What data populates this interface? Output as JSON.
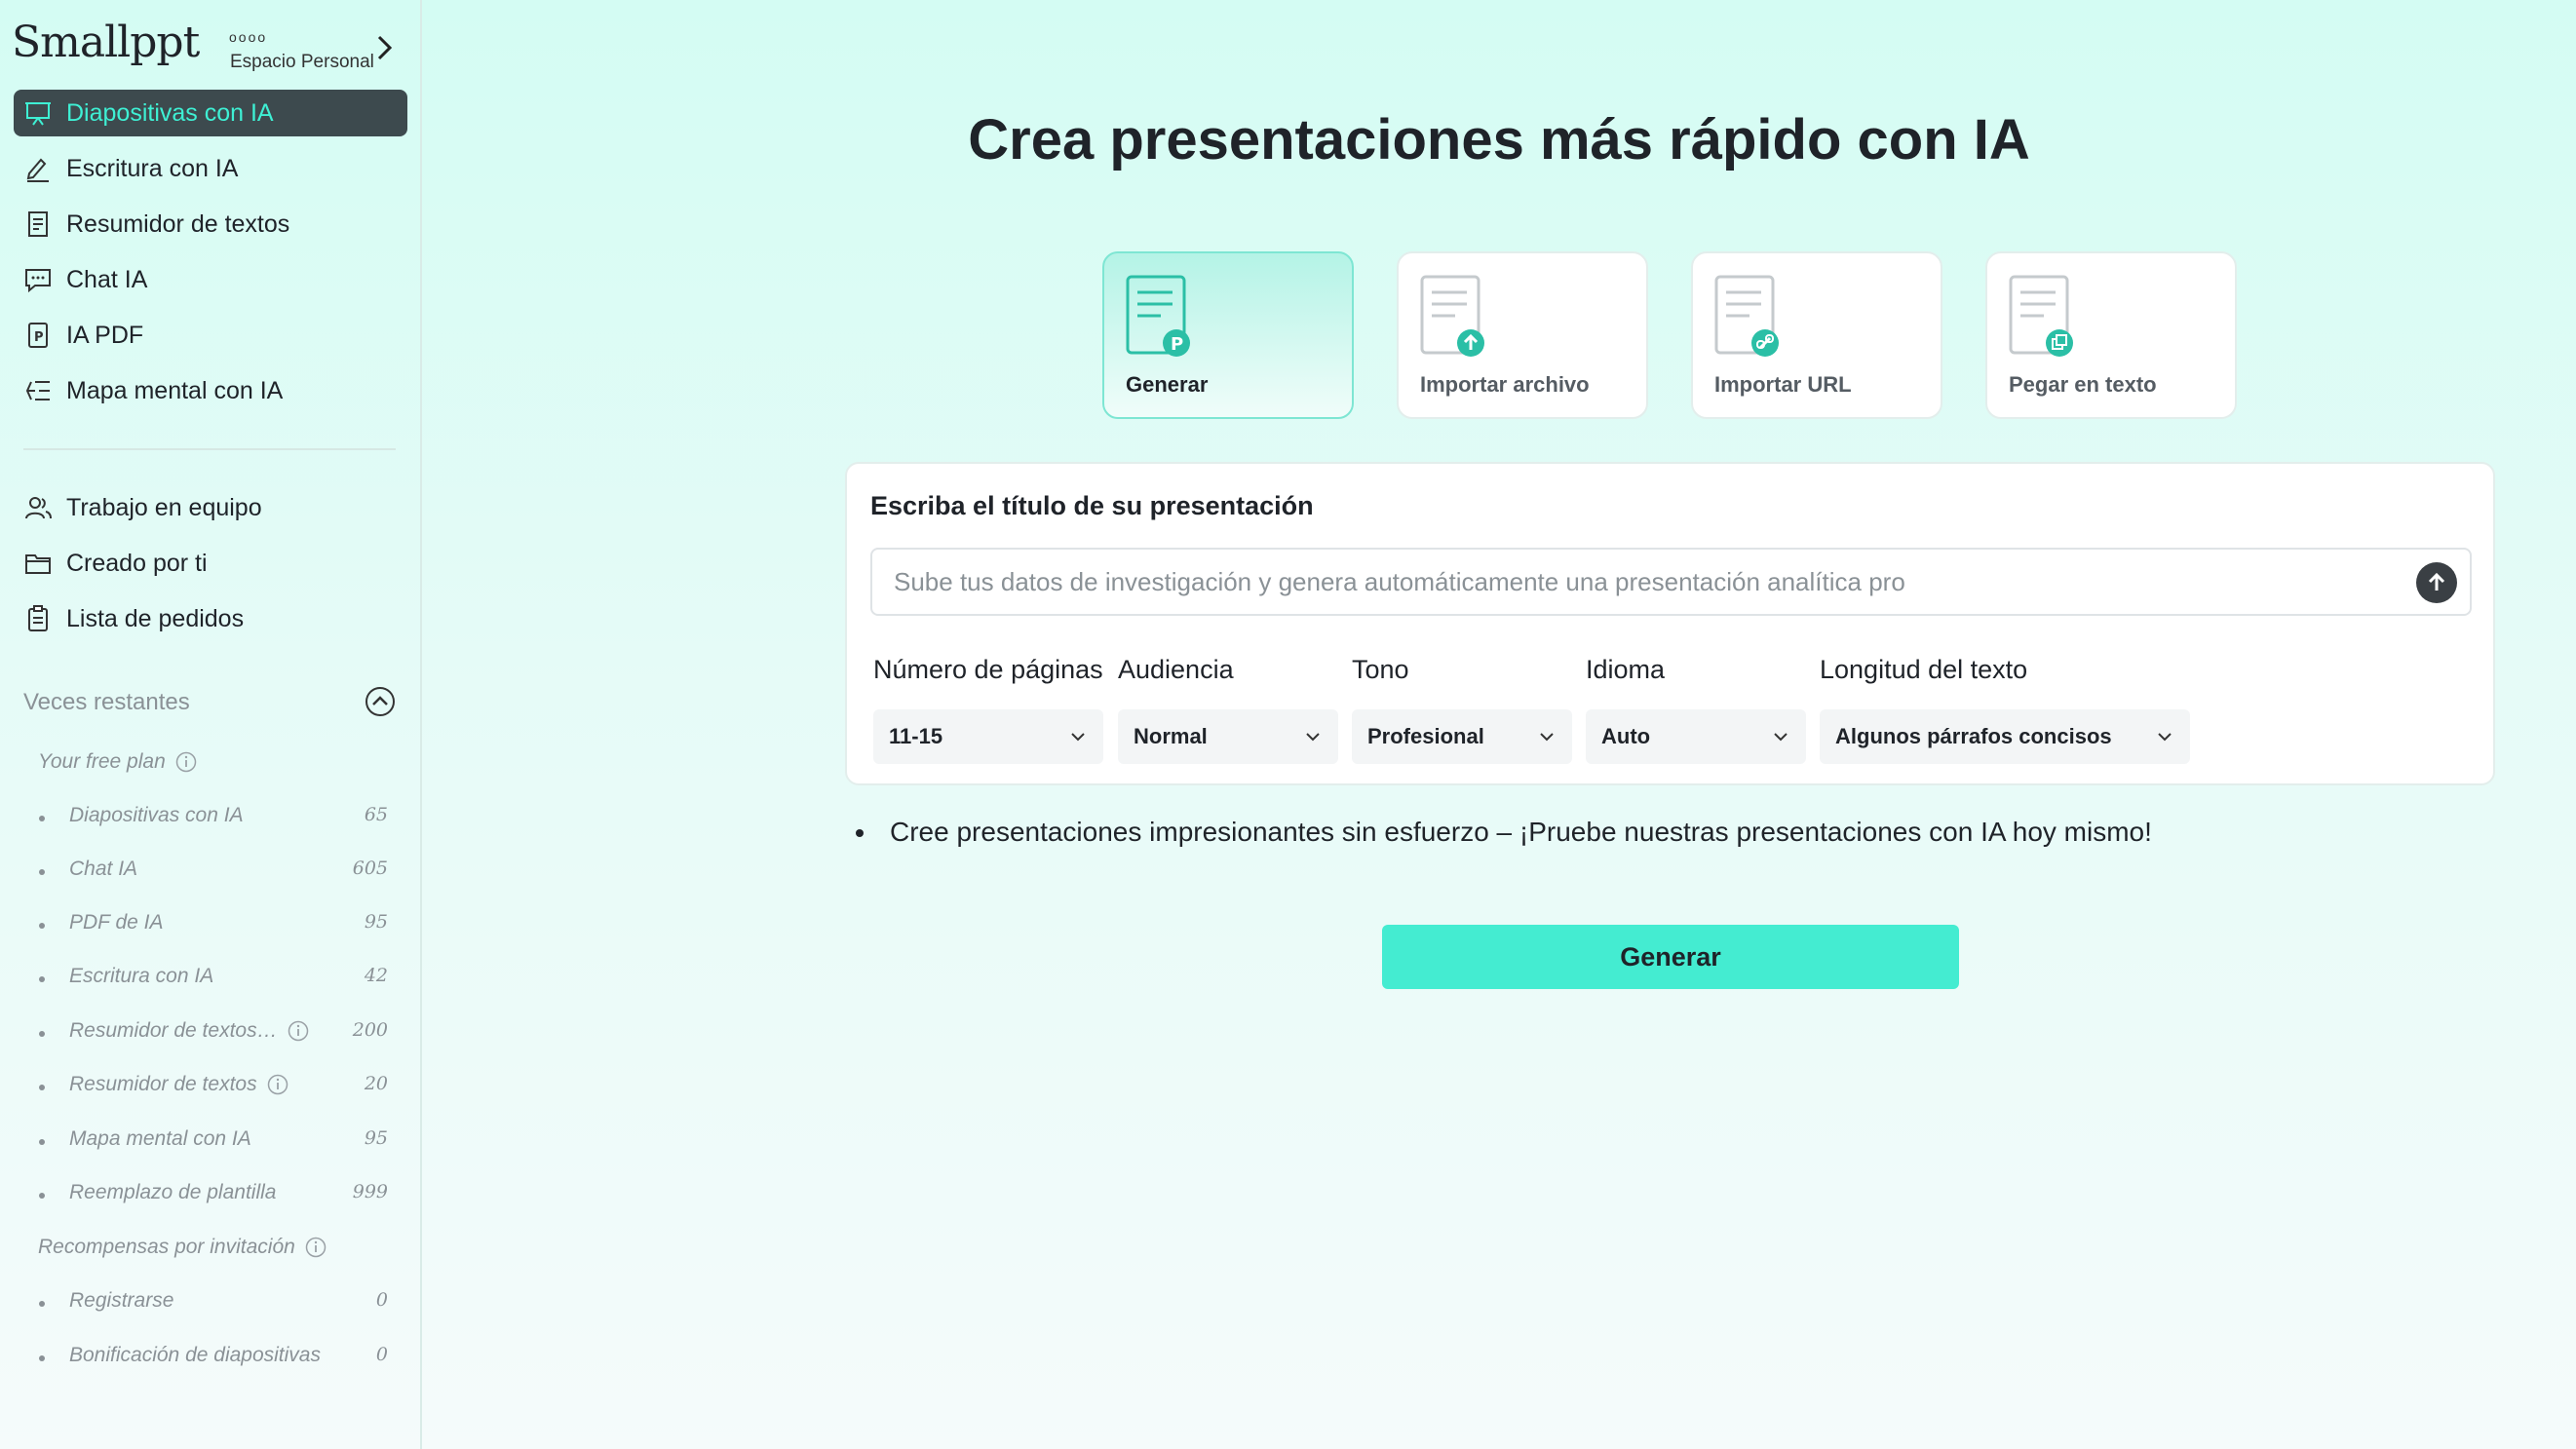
{
  "sidebar": {
    "logo": "Smallppt",
    "workspace": {
      "dots": "oooo",
      "label": "Espacio Personal"
    },
    "nav": [
      {
        "label": "Diapositivas con IA",
        "icon": "presentation-icon",
        "active": true
      },
      {
        "label": "Escritura con IA",
        "icon": "pen-writing-icon"
      },
      {
        "label": "Resumidor de textos",
        "icon": "document-summary-icon"
      },
      {
        "label": "Chat IA",
        "icon": "chat-icon"
      },
      {
        "label": "IA PDF",
        "icon": "pdf-icon"
      },
      {
        "label": "Mapa mental con IA",
        "icon": "mind-map-icon"
      }
    ],
    "nav2": [
      {
        "label": "Trabajo en equipo",
        "icon": "team-icon"
      },
      {
        "label": "Creado por ti",
        "icon": "folder-icon"
      },
      {
        "label": "Lista de pedidos",
        "icon": "clipboard-icon"
      }
    ],
    "remaining": {
      "title": "Veces restantes",
      "free_plan": "Your free plan",
      "items": [
        {
          "label": "Diapositivas con IA",
          "value": "65"
        },
        {
          "label": "Chat IA",
          "value": "605"
        },
        {
          "label": "PDF de IA",
          "value": "95"
        },
        {
          "label": "Escritura con IA",
          "value": "42"
        },
        {
          "label": "Resumidor de textos…",
          "value": "200"
        },
        {
          "label": "Resumidor de textos",
          "value": "20"
        },
        {
          "label": "Mapa mental con IA",
          "value": "95"
        },
        {
          "label": "Reemplazo de plantilla",
          "value": "999"
        }
      ],
      "rewards": "Recompensas por invitación",
      "reward_items": [
        {
          "label": "Registrarse",
          "value": "0"
        },
        {
          "label": "Bonificación de diapositivas",
          "value": "0"
        }
      ]
    }
  },
  "main": {
    "title": "Crea presentaciones más rápido con IA",
    "modes": [
      {
        "label": "Generar",
        "badge": "P",
        "active": true
      },
      {
        "label": "Importar archivo",
        "badge": "upload"
      },
      {
        "label": "Importar URL",
        "badge": "link"
      },
      {
        "label": "Pegar en texto",
        "badge": "paste"
      }
    ],
    "panel": {
      "title": "Escriba el título de su presentación",
      "placeholder": "Sube tus datos de investigación y genera automáticamente una presentación analítica pro",
      "value": "",
      "options": [
        {
          "label": "Número de páginas",
          "value": "11-15"
        },
        {
          "label": "Audiencia",
          "value": "Normal"
        },
        {
          "label": "Tono",
          "value": "Profesional"
        },
        {
          "label": "Idioma",
          "value": "Auto"
        },
        {
          "label": "Longitud del texto",
          "value": "Algunos párrafos concisos"
        }
      ]
    },
    "tip": "Cree presentaciones impresionantes sin esfuerzo – ¡Pruebe nuestras presentaciones con IA hoy mismo!",
    "generate_button": "Generar"
  },
  "colors": {
    "accent": "#44ecd1",
    "active_nav_bg": "#3d4a4e",
    "active_nav_text": "#3ef0d4",
    "icon_teal": "#2bbfa6"
  }
}
